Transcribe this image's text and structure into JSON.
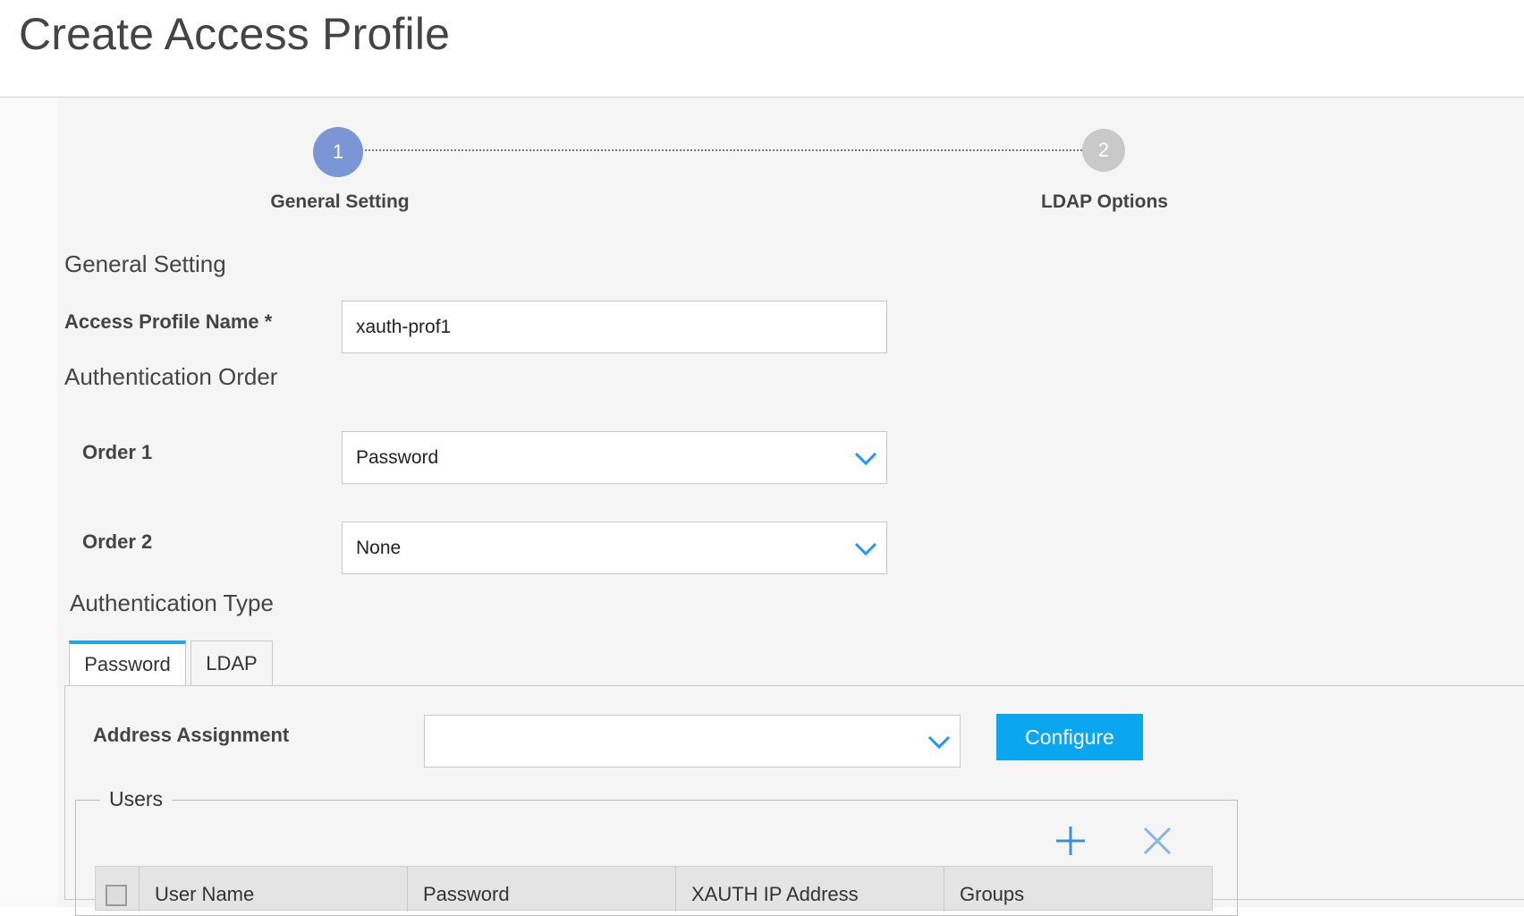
{
  "page": {
    "title": "Create Access Profile"
  },
  "wizard": {
    "steps": [
      {
        "number": "1",
        "label": "General Setting",
        "state": "active"
      },
      {
        "number": "2",
        "label": "LDAP Options",
        "state": "inactive"
      }
    ]
  },
  "general": {
    "section_title": "General Setting",
    "profile_name_label": "Access Profile Name *",
    "profile_name_value": "xauth-prof1"
  },
  "auth_order": {
    "section_title": "Authentication Order",
    "order1_label": "Order 1",
    "order1_value": "Password",
    "order2_label": "Order 2",
    "order2_value": "None"
  },
  "auth_type": {
    "section_title": "Authentication Type",
    "tabs": [
      {
        "label": "Password",
        "active": true
      },
      {
        "label": "LDAP",
        "active": false
      }
    ],
    "address_assignment_label": "Address Assignment",
    "address_assignment_value": "",
    "configure_label": "Configure"
  },
  "users": {
    "legend": "Users",
    "columns": [
      "User Name",
      "Password",
      "XAUTH IP Address",
      "Groups"
    ]
  },
  "colors": {
    "accent": "#0aa7f0",
    "step_active": "#7b96d4",
    "step_inactive": "#c9c9c9",
    "chevron": "#2196f3"
  },
  "icons": [
    "chevron-down-icon",
    "plus-icon",
    "close-icon"
  ]
}
